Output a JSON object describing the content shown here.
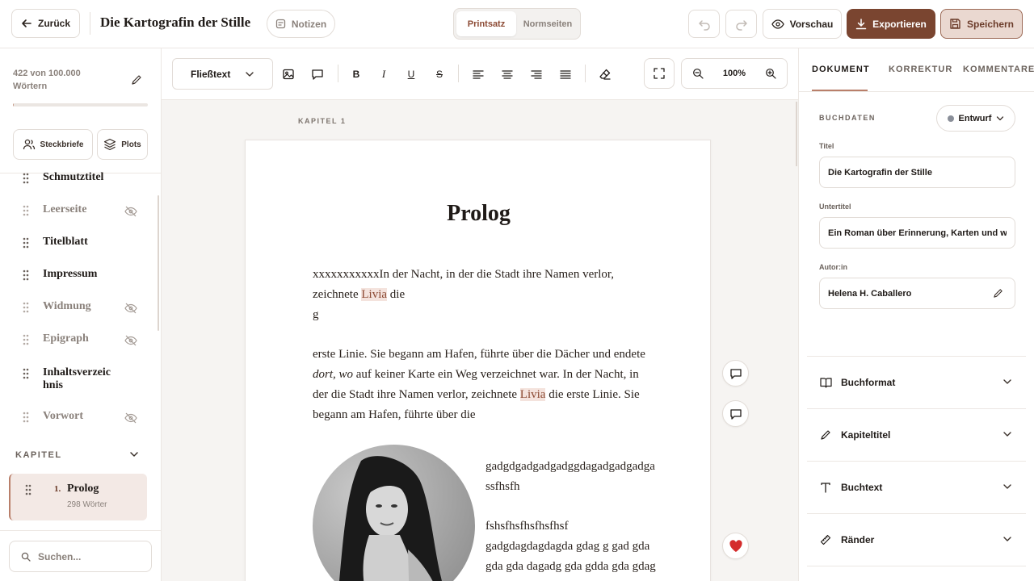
{
  "header": {
    "back_label": "Zurück",
    "title": "Die Kartografin der Stille",
    "notes_label": "Notizen",
    "view_modes": [
      "Printsatz",
      "Normseiten"
    ],
    "active_view": "Printsatz",
    "preview_label": "Vorschau",
    "export_label": "Exportieren",
    "save_label": "Speichern"
  },
  "sidebar": {
    "word_count_line1": "422 von 100.000",
    "word_count_line2": "Wörtern",
    "word_progress_fraction": 0.00422,
    "characters_label": "Steckbriefe",
    "plots_label": "Plots",
    "front_matter": [
      {
        "label": "Schmutztitel",
        "hidden": false
      },
      {
        "label": "Leerseite",
        "hidden": true
      },
      {
        "label": "Titelblatt",
        "hidden": false
      },
      {
        "label": "Impressum",
        "hidden": false
      },
      {
        "label": "Widmung",
        "hidden": true
      },
      {
        "label": "Epigraph",
        "hidden": true
      },
      {
        "label": "Inhaltsverzeic hnis",
        "hidden": false
      },
      {
        "label": "Vorwort",
        "hidden": true
      }
    ],
    "chapters_heading": "KAPITEL",
    "chapters": [
      {
        "number": "1.",
        "title": "Prolog",
        "words": "298 Wörter"
      }
    ],
    "search_placeholder": "Suchen..."
  },
  "toolbar": {
    "paragraph_style": "Fließtext",
    "bold": "B",
    "italic": "I",
    "underline": "U",
    "strike": "S",
    "zoom": "100%"
  },
  "editor": {
    "chapter_kicker": "KAPITEL 1",
    "page_title": "Prolog",
    "para1_a": "xxxxxxxxxxxIn der Nacht, in der die Stadt ihre Namen verlor, zeichnete ",
    "para1_name": "Livia",
    "para1_b": " die",
    "para1_c": "g",
    "para2_a": "erste Linie. Sie begann am Hafen, führte über die Dächer und endete ",
    "para2_italic": "dort, wo",
    "para2_b": " auf keiner Karte ein Weg verzeichnet war. In der Nacht, in der die Stadt ihre Namen verlor, zeichnete ",
    "para2_name": "Livia",
    "para2_c": " die erste Linie. Sie begann am Hafen, führte über die",
    "side_text1": "gadgdgadgadgadggdagadgadgadga ssfhsfh",
    "side_text2": "fshsfhsfhsfhsfhsf gadgdagdagdagda gdag g gad gda gda gda dagadg gda gdda gda gdag"
  },
  "right_panel": {
    "tabs": [
      "DOKUMENT",
      "KORREKTUR",
      "KOMMENTARE"
    ],
    "active_tab": "DOKUMENT",
    "section_heading": "BUCHDATEN",
    "status_label": "Entwurf",
    "status_color": "#8a8f99",
    "fields": {
      "title_label": "Titel",
      "title_value": "Die Kartografin der Stille",
      "subtitle_label": "Untertitel",
      "subtitle_value": "Ein Roman über Erinnerung, Karten und w",
      "author_label": "Autor:in",
      "author_value": "Helena H. Caballero"
    },
    "accordions": [
      "Buchformat",
      "Kapiteltitel",
      "Buchtext",
      "Ränder"
    ]
  },
  "colors": {
    "accent": "#7a4530",
    "accent_light": "#ead8d0",
    "highlight": "#f4e3dd",
    "border": "#e2dcd7"
  }
}
